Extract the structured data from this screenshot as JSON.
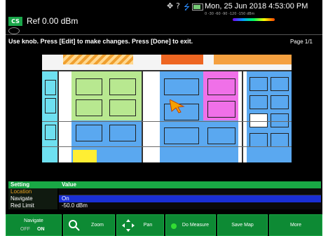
{
  "status": {
    "datetime": "Mon, 25 Jun 2018 4:53:00 PM",
    "scale_labels": "0    -30    -60    -90    -120   -150 dBm"
  },
  "header": {
    "mode_badge": "CS",
    "ref_level": "Ref 0.00 dBm"
  },
  "instruction": "Use knob. Press [Edit] to make changes. Press [Done] to exit.",
  "page_indicator": "Page 1/1",
  "table": {
    "headers": {
      "setting": "Setting",
      "value": "Value"
    },
    "rows": [
      {
        "setting": "Location",
        "value": ""
      },
      {
        "setting": "Navigate",
        "value": "On"
      },
      {
        "setting": "Red Limit",
        "value": "-50.0 dBm"
      }
    ]
  },
  "softkeys": {
    "navigate_label": "Navigate",
    "navigate_state_off": "OFF",
    "navigate_state_on": "ON",
    "zoom": "Zoom",
    "pan": "Pan",
    "do_measure": "Do Measure",
    "save_map": "Save Map",
    "more": "More"
  },
  "colors": {
    "accent_green": "#0d8a34",
    "header_green": "#19a845",
    "selected_blue": "#1a2fd4",
    "location_text": "#e8a020"
  }
}
